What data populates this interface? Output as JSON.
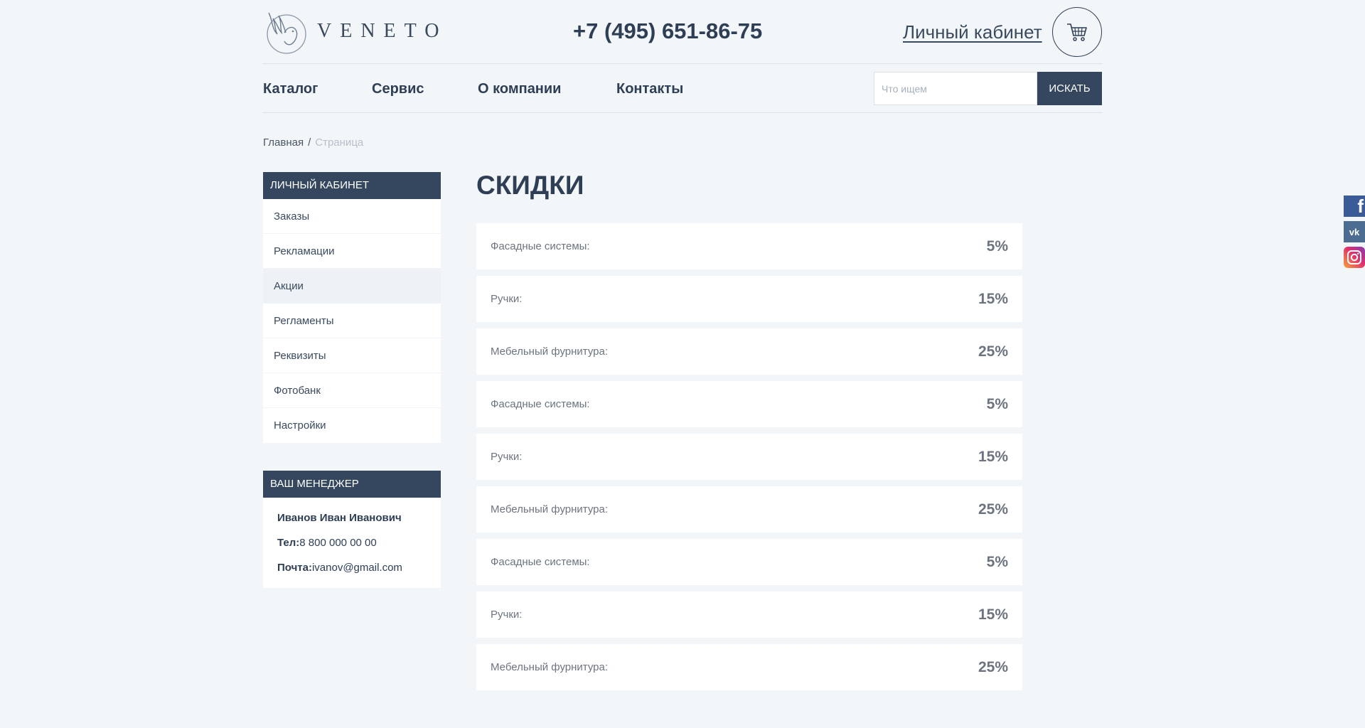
{
  "brand": {
    "name": "VENETO"
  },
  "header": {
    "phone": "+7 (495) 651-86-75",
    "account_link": "Личный кабинет"
  },
  "nav": {
    "items": [
      "Каталог",
      "Сервис",
      "О компании",
      "Контакты"
    ]
  },
  "search": {
    "placeholder": "Что ищем",
    "button": "ИСКАТЬ"
  },
  "breadcrumb": {
    "home": "Главная",
    "separator": "/",
    "current": "Страница"
  },
  "sidebar": {
    "title": "Личный кабинет",
    "items": [
      {
        "label": "Заказы"
      },
      {
        "label": "Рекламации"
      },
      {
        "label": "Акции",
        "active": true
      },
      {
        "label": "Регламенты"
      },
      {
        "label": "Реквизиты"
      },
      {
        "label": "Фотобанк"
      },
      {
        "label": "Настройки"
      }
    ]
  },
  "manager": {
    "title": "Ваш менеджер",
    "name": "Иванов Иван Иванович",
    "phone_label": "Тел:",
    "phone": "8 800 000 00 00",
    "email_label": "Почта:",
    "email": "ivanov@gmail.com"
  },
  "main": {
    "title": "СКИДКИ",
    "discounts": [
      {
        "label": "Фасадные системы:",
        "value": "5%"
      },
      {
        "label": "Ручки:",
        "value": "15%"
      },
      {
        "label": "Мебельный фурнитура:",
        "value": "25%"
      },
      {
        "label": "Фасадные системы:",
        "value": "5%"
      },
      {
        "label": "Ручки:",
        "value": "15%"
      },
      {
        "label": "Мебельный фурнитура:",
        "value": "25%"
      },
      {
        "label": "Фасадные системы:",
        "value": "5%"
      },
      {
        "label": "Ручки:",
        "value": "15%"
      },
      {
        "label": "Мебельный фурнитура:",
        "value": "25%"
      }
    ]
  },
  "social": {
    "items": [
      {
        "name": "facebook",
        "glyph": "f"
      },
      {
        "name": "vk",
        "glyph": "vk"
      },
      {
        "name": "instagram",
        "glyph": ""
      }
    ]
  },
  "colors": {
    "primary": "#34475f",
    "background": "#f3f6f9",
    "text": "#2e3e55"
  }
}
